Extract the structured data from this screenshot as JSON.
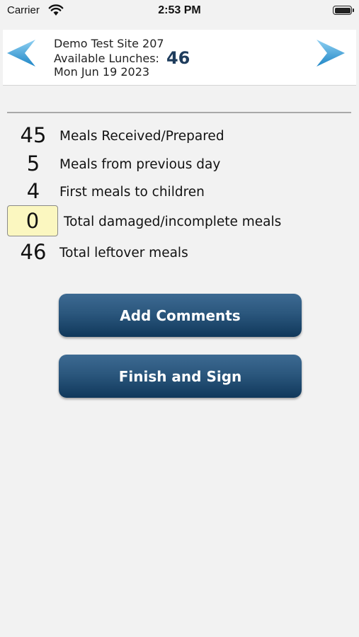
{
  "status_bar": {
    "carrier": "Carrier",
    "time": "2:53 PM"
  },
  "header": {
    "site_name": "Demo Test Site 207",
    "available_label": "Available Lunches:",
    "available_count": "46",
    "date": "Mon Jun 19 2023",
    "prev_icon": "arrow-left-icon",
    "next_icon": "arrow-right-icon",
    "accent_color": "#3aa0dc"
  },
  "meals": [
    {
      "value": "45",
      "label": "Meals Received/Prepared",
      "editable": false
    },
    {
      "value": "5",
      "label": "Meals from previous day",
      "editable": false
    },
    {
      "value": "4",
      "label": "First meals to children",
      "editable": false
    },
    {
      "value": "0",
      "label": "Total damaged/incomplete meals",
      "editable": true
    },
    {
      "value": "46",
      "label": "Total leftover meals",
      "editable": false
    }
  ],
  "buttons": {
    "add_comments": "Add Comments",
    "finish_and_sign": "Finish and Sign"
  },
  "colors": {
    "button": "#1e4a70",
    "input_bg": "#fbf7c0",
    "background": "#f2f2f2"
  }
}
